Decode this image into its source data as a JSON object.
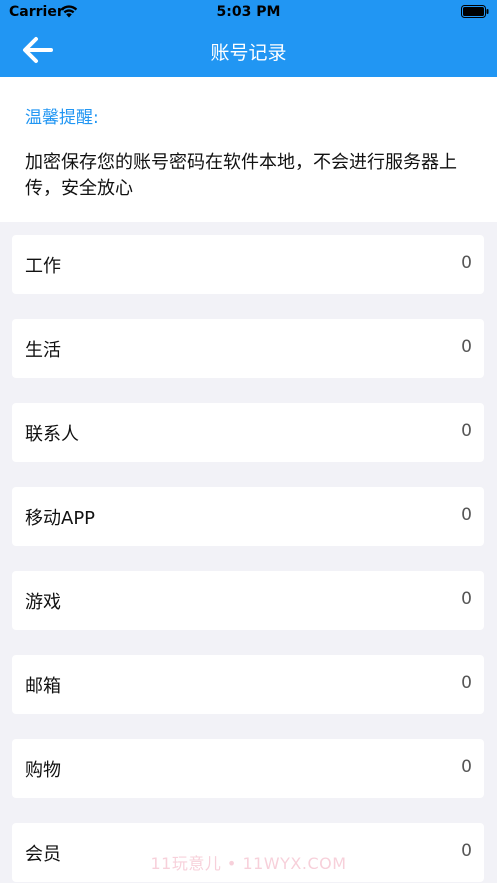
{
  "status_bar": {
    "carrier": "Carrier",
    "time": "5:03 PM"
  },
  "nav": {
    "title": "账号记录",
    "back_icon": "arrow-left-icon"
  },
  "notice": {
    "title": "温馨提醒:",
    "text": "加密保存您的账号密码在软件本地，不会进行服务器上传，安全放心"
  },
  "categories": [
    {
      "label": "工作",
      "count": "0"
    },
    {
      "label": "生活",
      "count": "0"
    },
    {
      "label": "联系人",
      "count": "0"
    },
    {
      "label": "移动APP",
      "count": "0"
    },
    {
      "label": "游戏",
      "count": "0"
    },
    {
      "label": "邮箱",
      "count": "0"
    },
    {
      "label": "购物",
      "count": "0"
    },
    {
      "label": "会员",
      "count": "0"
    }
  ],
  "watermark": "11玩意儿 • 11WYX.COM",
  "colors": {
    "accent": "#2196f3",
    "background": "#f2f2f7",
    "card": "#ffffff"
  }
}
